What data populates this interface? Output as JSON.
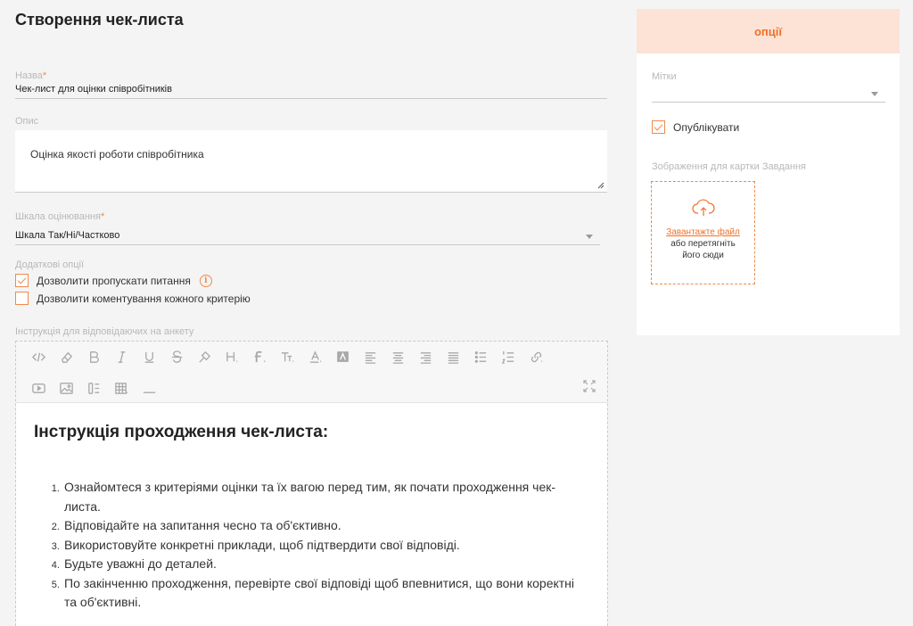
{
  "page": {
    "title": "Створення чек-листа"
  },
  "form": {
    "name_label": "Назва",
    "required_mark": "*",
    "name_value": "Чек-лист для оцінки співробітників",
    "description_label": "Опис",
    "description_value": "Оцінка якості роботи співробітника",
    "scale_label": "Шкала оцінювання",
    "scale_value": "Шкала Так/Ні/Частково",
    "extra_label": "Додаткові опції",
    "option_skip": "Дозволити пропускати питання",
    "option_skip_checked": true,
    "option_comment": "Дозволити коментування кожного критерію",
    "option_comment_checked": false,
    "instruction_label": "Інструкція для відповідаючих на анкету"
  },
  "editor": {
    "toolbar_icons": [
      "code-view-icon",
      "eraser-icon",
      "bold-icon",
      "italic-icon",
      "underline-icon",
      "strikethrough-icon",
      "format-painter-icon",
      "heading-icon",
      "font-family-icon",
      "font-size-icon",
      "font-color-icon",
      "background-color-icon",
      "align-left-icon",
      "align-center-icon",
      "align-right-icon",
      "align-justify-icon",
      "bullet-list-icon",
      "numbered-list-icon",
      "link-icon",
      "video-icon",
      "image-icon",
      "paragraph-format-icon",
      "table-icon",
      "horizontal-line-icon",
      "fullscreen-icon"
    ],
    "heading": "Інструкція проходження чек-листа:",
    "items": [
      "Ознайомтеся з критеріями оцінки та їх вагою перед тим, як почати проходження чек-листа.",
      "Відповідайте на запитання чесно та об'єктивно.",
      "Використовуйте конкретні приклади, щоб підтвердити свої відповіді.",
      "Будьте уважні до деталей.",
      "По закінченню проходження, перевірте свої відповіді щоб впевнитися, що вони коректні та об'єктивні."
    ]
  },
  "options_panel": {
    "title": "опції",
    "tags_label": "Мітки",
    "tags_value": "",
    "publish_label": "Опублікувати",
    "publish_checked": true,
    "image_label": "Зображення для картки Завдання",
    "upload_link": "Завантажте файл",
    "upload_hint_1": "або перетягніть",
    "upload_hint_2": "його сюди"
  },
  "colors": {
    "accent": "#f07028",
    "panel_header_bg": "#fde3d6",
    "page_bg": "#f4f4f4"
  }
}
